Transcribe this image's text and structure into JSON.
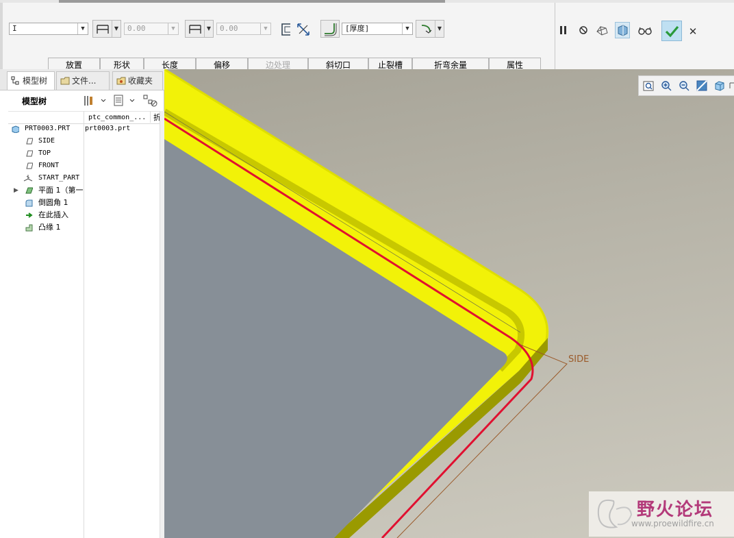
{
  "dashboard": {
    "type_combo": "I",
    "length1_value": "0.00",
    "length2_value": "0.00",
    "thickness_combo": "[厚度]",
    "tabs": [
      "放置",
      "形状",
      "长度",
      "偏移",
      "边处理",
      "斜切口",
      "止裂槽",
      "折弯余量",
      "属性"
    ]
  },
  "panel": {
    "tabs": [
      "模型树",
      "文件...",
      "收藏夹"
    ],
    "toolbar_label": "模型树",
    "column_header": "ptc_common_...",
    "column_header2": "折",
    "tree": [
      {
        "label": "PRT0003.PRT",
        "col2": "prt0003.prt",
        "icon": "part-icon"
      },
      {
        "label": "SIDE",
        "icon": "datum-plane-icon"
      },
      {
        "label": "TOP",
        "icon": "datum-plane-icon"
      },
      {
        "label": "FRONT",
        "icon": "datum-plane-icon"
      },
      {
        "label": "START_PART",
        "icon": "csys-icon"
      },
      {
        "label": "平面 1（第一",
        "icon": "planar-wall-icon"
      },
      {
        "label": "倒圆角 1",
        "icon": "round-icon"
      },
      {
        "label": "在此插入",
        "icon": "insert-here-arrow-icon"
      },
      {
        "label": "凸缘 1",
        "icon": "flange-icon"
      }
    ]
  },
  "viewport": {
    "datum_label": "SIDE",
    "watermark_title": "野火论坛",
    "watermark_url": "www.proewildfire.cn"
  },
  "colors": {
    "wall_yellow": "#e0e000",
    "edge_red": "#e01030",
    "flat_face": "#878f97",
    "ok_button": "#bfe0f2"
  }
}
